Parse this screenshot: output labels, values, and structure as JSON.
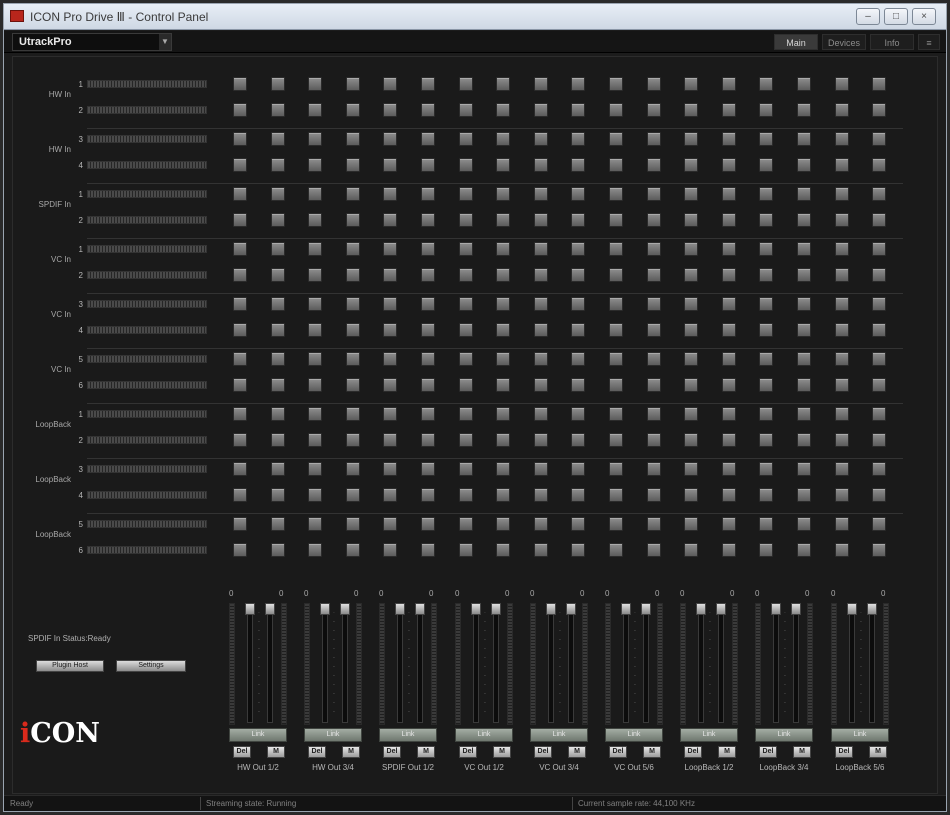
{
  "window": {
    "title": "ICON Pro Drive Ⅲ - Control Panel",
    "minimize": "–",
    "maximize": "□",
    "close": "×"
  },
  "toolbar": {
    "device": "UtrackPro",
    "tabs": [
      "Main",
      "Devices",
      "Info"
    ],
    "active_tab": "Main",
    "menu_icon": "≡"
  },
  "inputs": [
    {
      "group": "HW In",
      "channels": [
        "1",
        "2"
      ]
    },
    {
      "group": "HW In",
      "channels": [
        "3",
        "4"
      ]
    },
    {
      "group": "SPDIF In",
      "channels": [
        "1",
        "2"
      ]
    },
    {
      "group": "VC In",
      "channels": [
        "1",
        "2"
      ]
    },
    {
      "group": "VC In",
      "channels": [
        "3",
        "4"
      ]
    },
    {
      "group": "VC In",
      "channels": [
        "5",
        "6"
      ]
    },
    {
      "group": "LoopBack",
      "channels": [
        "1",
        "2"
      ]
    },
    {
      "group": "LoopBack",
      "channels": [
        "3",
        "4"
      ]
    },
    {
      "group": "LoopBack",
      "channels": [
        "5",
        "6"
      ]
    }
  ],
  "outputs": [
    {
      "label": "HW Out 1/2",
      "left_value": "0",
      "right_value": "0"
    },
    {
      "label": "HW Out 3/4",
      "left_value": "0",
      "right_value": "0"
    },
    {
      "label": "SPDIF Out 1/2",
      "left_value": "0",
      "right_value": "0"
    },
    {
      "label": "VC Out 1/2",
      "left_value": "0",
      "right_value": "0"
    },
    {
      "label": "VC Out 3/4",
      "left_value": "0",
      "right_value": "0"
    },
    {
      "label": "VC Out 5/6",
      "left_value": "0",
      "right_value": "0"
    },
    {
      "label": "LoopBack 1/2",
      "left_value": "0",
      "right_value": "0"
    },
    {
      "label": "LoopBack 3/4",
      "left_value": "0",
      "right_value": "0"
    },
    {
      "label": "LoopBack 5/6",
      "left_value": "0",
      "right_value": "0"
    }
  ],
  "strip_buttons": {
    "link": "Link",
    "solo": "Del",
    "mute": "M"
  },
  "spdif_status": "SPDIF In Status:Ready",
  "buttons": {
    "plugin_host": "Plugin Host",
    "settings": "Settings"
  },
  "logo": {
    "first": "i",
    "rest": "CON"
  },
  "statusbar": {
    "ready": "Ready",
    "streaming": "Streaming state: Running",
    "sample_rate": "Current sample rate: 44,100 KHz"
  },
  "colors": {
    "background": "#1a1a1a",
    "accent": "#d92a1c",
    "matrix_cell": "#7a7a7a"
  }
}
